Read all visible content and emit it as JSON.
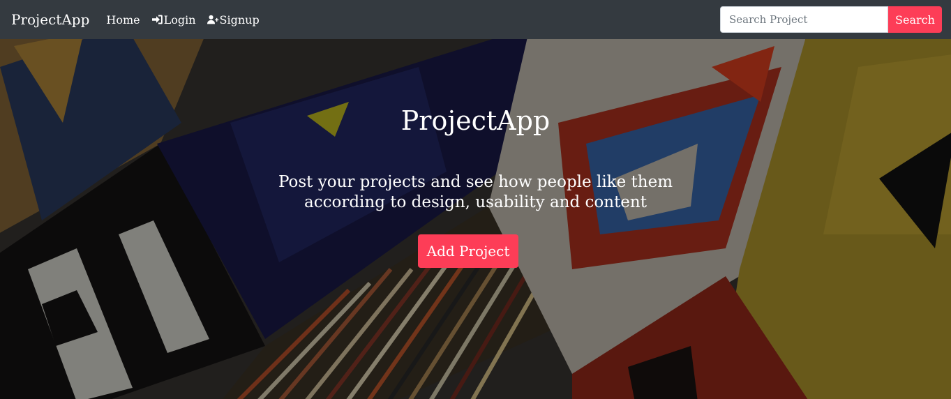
{
  "navbar": {
    "brand": "ProjectApp",
    "links": [
      {
        "label": "Home",
        "icon": null
      },
      {
        "label": "Login",
        "icon": "sign-in-icon"
      },
      {
        "label": "Signup",
        "icon": "user-plus-icon"
      }
    ],
    "search": {
      "placeholder": "Search Project",
      "value": "",
      "button_label": "Search"
    }
  },
  "hero": {
    "title": "ProjectApp",
    "subtitle": "Post your projects and see how people like them according to design, usability and content",
    "cta_label": "Add Project",
    "background": "painted-boards-collage-image"
  },
  "colors": {
    "navbar_bg": "#343a40",
    "accent": "#fd3d57",
    "text": "#ffffff"
  }
}
